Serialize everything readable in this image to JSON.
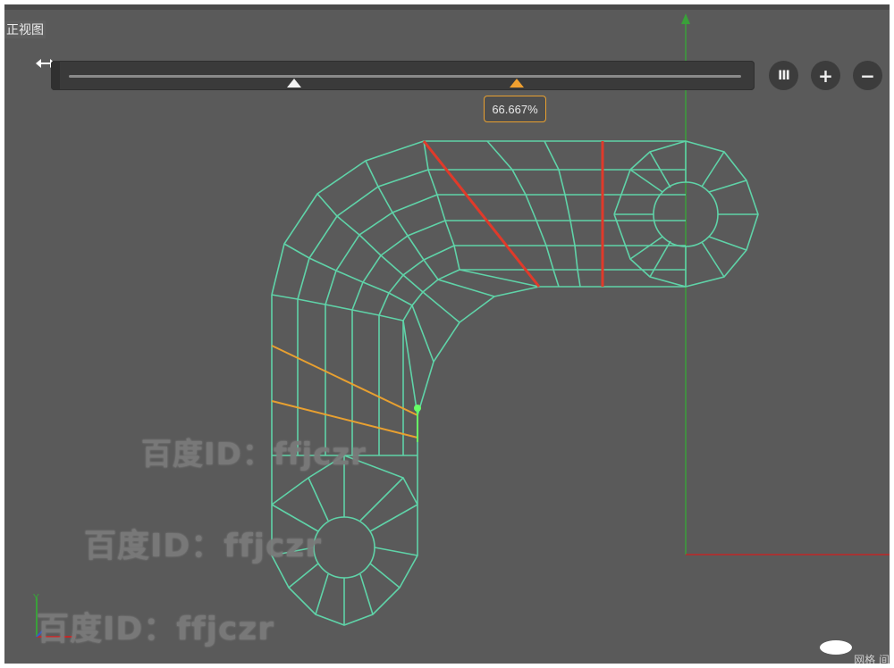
{
  "viewport": {
    "view_label": "正视图",
    "corner_label": "网格 间"
  },
  "slider": {
    "value_label": "66.667%",
    "value_fraction": 0.66667
  },
  "buttons": {
    "bars_label": "III",
    "plus_label": "+",
    "minus_label": "−"
  },
  "watermarks": [
    "百度ID：ffjczr",
    "百度ID：ffjczr",
    "百度ID：ffjczr"
  ],
  "colors": {
    "viewport_bg": "#5a5a5a",
    "mesh": "#5fd3a8",
    "red_edges": "#e03a2a",
    "orange_edges": "#e8a030",
    "axis_green": "#3aa03a",
    "axis_red": "#c02828",
    "selected_vertex": "#66ff66"
  },
  "icons": [
    "resize-horizontal-icon",
    "bars-icon",
    "plus-icon",
    "minus-icon",
    "axis-gizmo-icon"
  ]
}
